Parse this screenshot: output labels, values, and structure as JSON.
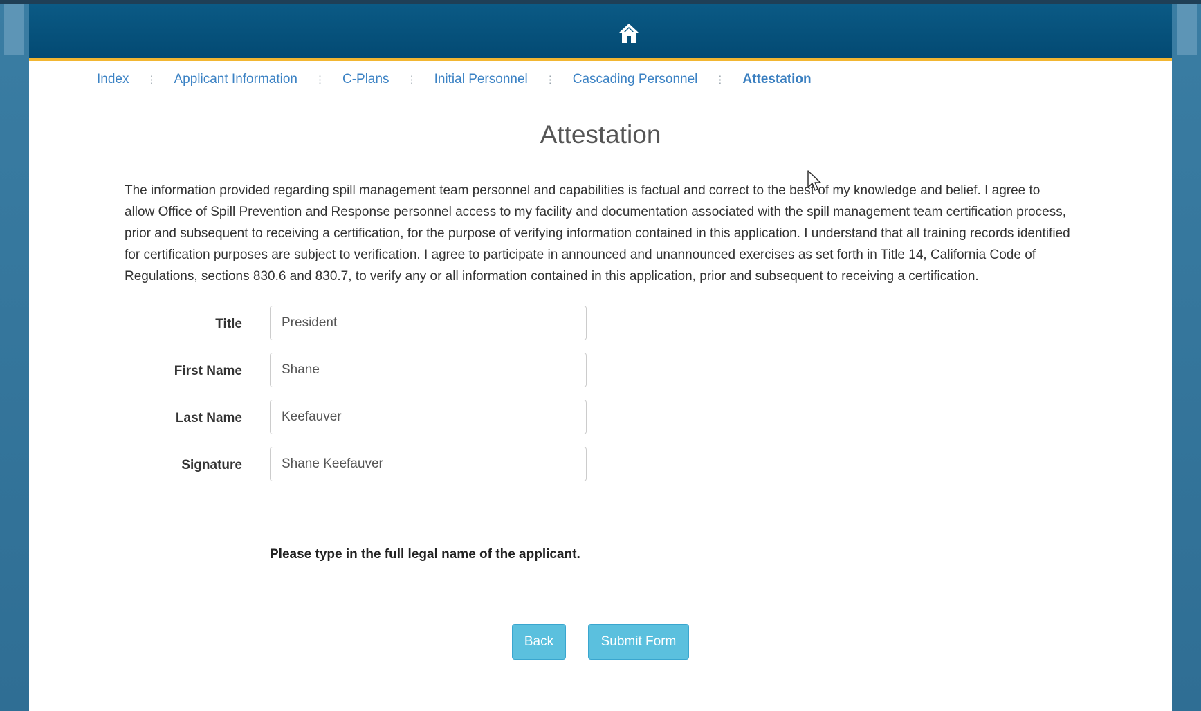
{
  "breadcrumb": {
    "items": [
      {
        "label": "Index",
        "active": false
      },
      {
        "label": "Applicant Information",
        "active": false
      },
      {
        "label": "C-Plans",
        "active": false
      },
      {
        "label": "Initial Personnel",
        "active": false
      },
      {
        "label": "Cascading Personnel",
        "active": false
      },
      {
        "label": "Attestation",
        "active": true
      }
    ]
  },
  "page": {
    "title": "Attestation",
    "attestation_text": "The information provided regarding spill management team personnel and capabilities is factual and correct to the best of my knowledge and belief. I agree to allow Office of Spill Prevention and Response personnel access to my facility and documentation associated with the spill management team certification process, prior and subsequent to receiving a certification, for the purpose of verifying information contained in this application. I understand that all training records identified for certification purposes are subject to verification. I agree to participate in announced and unannounced exercises as set forth in Title 14, California Code of Regulations, sections 830.6 and 830.7, to verify any or all information contained in this application, prior and subsequent to receiving a certification."
  },
  "form": {
    "title": {
      "label": "Title",
      "value": "President"
    },
    "first_name": {
      "label": "First Name",
      "value": "Shane"
    },
    "last_name": {
      "label": "Last Name",
      "value": "Keefauver"
    },
    "signature": {
      "label": "Signature",
      "value": "Shane Keefauver"
    },
    "help_text": "Please type in the full legal name of the applicant."
  },
  "buttons": {
    "back": "Back",
    "submit": "Submit Form"
  },
  "colors": {
    "header": "#034a73",
    "accent_stripe": "#f2b632",
    "link": "#3b82c4",
    "button": "#5bc0de"
  },
  "icons": {
    "home": "home-icon",
    "cursor": "cursor-icon"
  }
}
